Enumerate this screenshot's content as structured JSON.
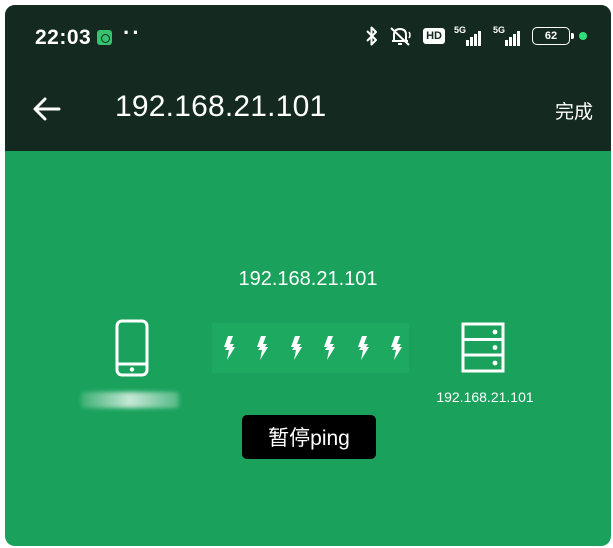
{
  "status_bar": {
    "time": "22:03",
    "dots": "··",
    "hd_label": "HD",
    "network_label_1": "5G",
    "network_label_2": "5G",
    "battery_level": "62",
    "icons": [
      "app-notification-icon",
      "bluetooth-icon",
      "mute-icon",
      "hd-icon",
      "signal-icon",
      "battery-icon",
      "indicator-dot-icon"
    ]
  },
  "app_bar": {
    "title": "192.168.21.101",
    "done_label": "完成",
    "back_icon": "arrow-left-icon"
  },
  "ping": {
    "target_ip": "192.168.21.101",
    "device_name": "••••••••",
    "server_ip": "192.168.21.101",
    "bolt_count": 6,
    "source_icon": "phone-icon",
    "target_icon": "server-icon"
  },
  "toast": {
    "text": "暂停ping"
  },
  "colors": {
    "bar_bg": "#14291f",
    "main_bg": "#1aa25c",
    "track_bg": "#1ea960",
    "toast_bg": "#000000",
    "text": "#ffffff"
  }
}
